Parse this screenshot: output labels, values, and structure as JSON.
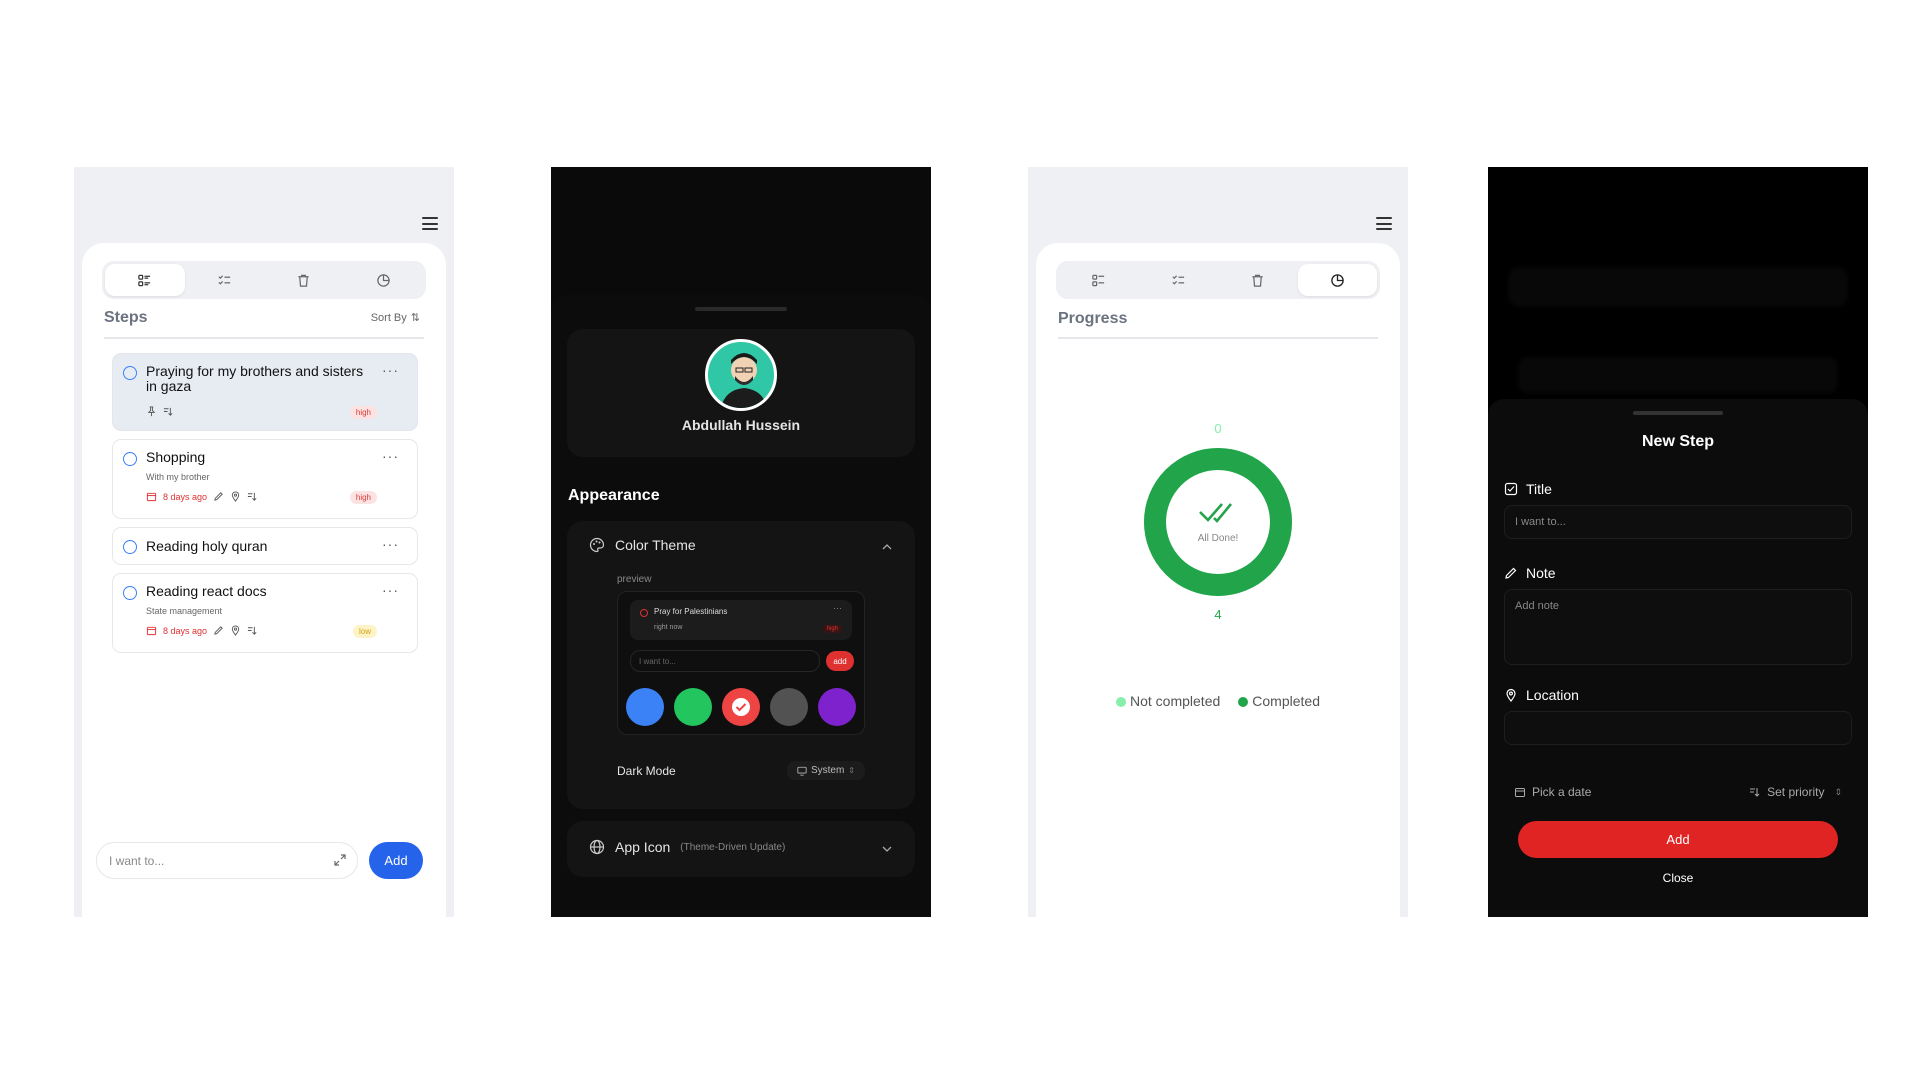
{
  "screen1": {
    "tabs": [
      "list-icon",
      "checklist-icon",
      "trash-icon",
      "pie-icon"
    ],
    "section_title": "Steps",
    "sort_label": "Sort By",
    "tasks": [
      {
        "title": "Praying for my brothers and sisters in gaza",
        "subtitle": "",
        "date": "",
        "priority": "high"
      },
      {
        "title": "Shopping",
        "subtitle": "With my brother",
        "date": "8 days ago",
        "priority": "high"
      },
      {
        "title": "Reading holy quran",
        "subtitle": "",
        "date": "",
        "priority": ""
      },
      {
        "title": "Reading react docs",
        "subtitle": "State management",
        "date": "8 days ago",
        "priority": "low"
      }
    ],
    "input_placeholder": "I want to...",
    "add_label": "Add"
  },
  "screen2": {
    "user_name": "Abdullah Hussein",
    "appearance_title": "Appearance",
    "color_theme_label": "Color Theme",
    "preview_label": "preview",
    "preview_task": "Pray for Palestinians",
    "preview_task_meta": "right now",
    "preview_badge": "high",
    "preview_input": "I want to...",
    "preview_add": "add",
    "swatches": [
      "#3b82f6",
      "#22c55e",
      "#ef4444",
      "#525252",
      "#7e22ce"
    ],
    "selected_swatch": "#ef4444",
    "dark_mode_label": "Dark Mode",
    "dark_mode_value": "System",
    "app_icon_label": "App Icon",
    "app_icon_note": "(Theme-Driven Update)"
  },
  "screen3": {
    "section_title": "Progress",
    "top_value": "0",
    "bottom_value": "4",
    "center_label": "All Done!",
    "legend": [
      {
        "label": "Not completed",
        "color": "#86efac"
      },
      {
        "label": "Completed",
        "color": "#22a44a"
      }
    ],
    "chart_completed": 4,
    "chart_not_completed": 0
  },
  "screen4": {
    "title": "New Step",
    "title_label": "Title",
    "title_placeholder": "I want to...",
    "note_label": "Note",
    "note_placeholder": "Add note",
    "location_label": "Location",
    "date_label": "Pick a date",
    "priority_label": "Set priority",
    "add_label": "Add",
    "close_label": "Close"
  }
}
